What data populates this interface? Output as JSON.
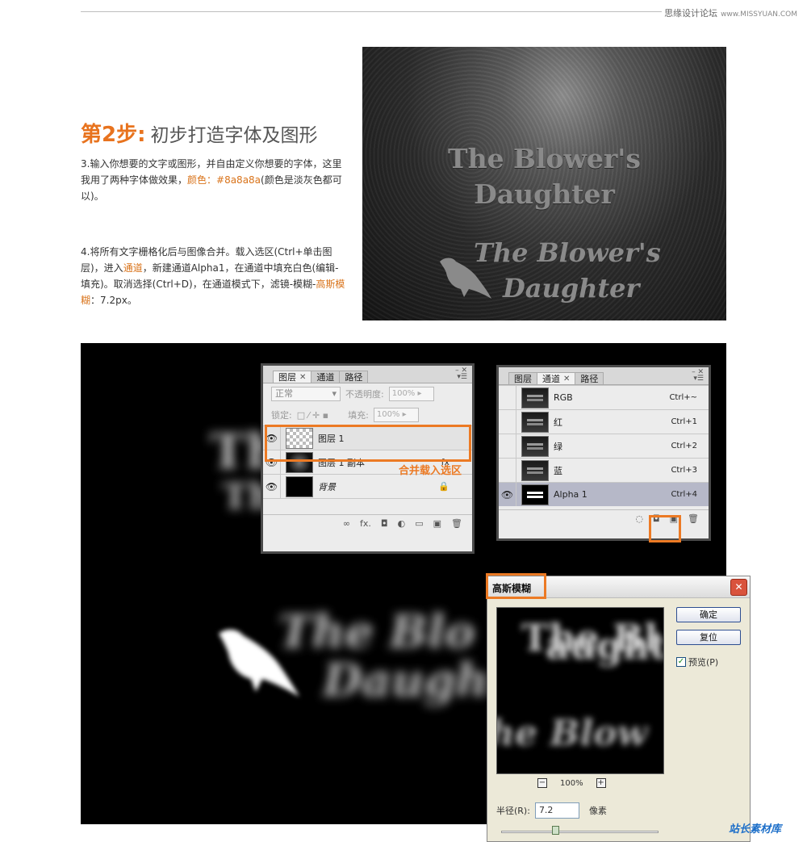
{
  "header": {
    "site_name": "思缘设计论坛",
    "site_url": "www.MISSYUAN.COM"
  },
  "step": {
    "number": "第2步:",
    "title": "初步打造字体及图形"
  },
  "paragraph3": {
    "text_a": "3.输入你想要的文字或图形，并自由定义你想要的字体，这里我用了两种字体做效果，",
    "highlight": "颜色：#8a8a8a",
    "text_b": "(颜色是淡灰色都可以)。"
  },
  "paragraph4": {
    "text_a": "4.将所有文字栅格化后与图像合并。载入选区(Ctrl+单击图层)，进入",
    "highlight_a": "通道",
    "text_b": "，新建通道Alpha1，在通道中填充白色(编辑-填充)。取消选择(Ctrl+D)，在通道模式下，滤镜-模糊-",
    "highlight_b": "高斯模糊",
    "text_c": "：7.2px。"
  },
  "hero": {
    "line1": "The Blower's",
    "line2": "Daughter",
    "script1": "The Blower's",
    "script2": "Daughter"
  },
  "canvas_text": {
    "big1": "The",
    "big2": "The Blo",
    "mid1": "The Blo",
    "mid2": "aughter",
    "mid3": "Daught"
  },
  "layers_panel": {
    "tabs": [
      "图层",
      "通道",
      "路径"
    ],
    "blend_mode": "正常",
    "opacity_label": "不透明度:",
    "opacity_value": "100%",
    "lock_label": "锁定:",
    "fill_label": "填充:",
    "fill_value": "100%",
    "layers": [
      {
        "name": "图层 1"
      },
      {
        "name": "图层 1 副本"
      },
      {
        "name": "背景"
      }
    ],
    "annotation": "合并载入选区"
  },
  "channels_panel": {
    "tabs": [
      "图层",
      "通道",
      "路径"
    ],
    "channels": [
      {
        "name": "RGB",
        "shortcut": "Ctrl+~"
      },
      {
        "name": "红",
        "shortcut": "Ctrl+1"
      },
      {
        "name": "绿",
        "shortcut": "Ctrl+2"
      },
      {
        "name": "蓝",
        "shortcut": "Ctrl+3"
      },
      {
        "name": "Alpha 1",
        "shortcut": "Ctrl+4"
      }
    ]
  },
  "gaussian_dialog": {
    "title": "高斯模糊",
    "ok_label": "确定",
    "reset_label": "复位",
    "preview_label": "预览(P)",
    "preview_checked": true,
    "zoom_value": "100%",
    "radius_label": "半径(R):",
    "radius_value": "7.2",
    "radius_unit": "像素",
    "slider_fraction": 0.35,
    "preview_text": {
      "line1": "The Bl",
      "line2": "aughte",
      "line3": "he Blow"
    }
  },
  "watermark": "站长素材库",
  "colors": {
    "accent": "#e8731e",
    "highlight": "#d9731a",
    "annotation_box": "#ec7a24"
  }
}
